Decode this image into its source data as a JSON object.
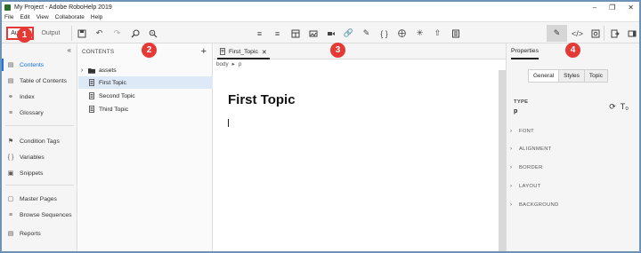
{
  "window": {
    "title": "My Project - Adobe RoboHelp 2019"
  },
  "menu": [
    "File",
    "Edit",
    "View",
    "Collaborate",
    "Help"
  ],
  "modes": {
    "author": "Author",
    "output": "Output"
  },
  "callouts": [
    "1",
    "2",
    "3",
    "4"
  ],
  "nav": {
    "items": [
      {
        "label": "Contents",
        "icon": "contents-icon",
        "active": true
      },
      {
        "label": "Table of Contents",
        "icon": "toc-icon"
      },
      {
        "label": "Index",
        "icon": "key-icon"
      },
      {
        "label": "Glossary",
        "icon": "glossary-icon"
      },
      {
        "label": "Condition Tags",
        "icon": "tag-icon"
      },
      {
        "label": "Variables",
        "icon": "braces-icon"
      },
      {
        "label": "Snippets",
        "icon": "snippet-icon"
      },
      {
        "label": "Master Pages",
        "icon": "master-page-icon"
      },
      {
        "label": "Browse Sequences",
        "icon": "sequence-icon"
      },
      {
        "label": "Reports",
        "icon": "reports-icon"
      }
    ]
  },
  "contents": {
    "header": "CONTENTS",
    "tree": [
      {
        "label": "assets",
        "type": "folder"
      },
      {
        "label": "First Topic",
        "type": "topic",
        "selected": true
      },
      {
        "label": "Second Topic",
        "type": "topic"
      },
      {
        "label": "Third Topic",
        "type": "topic"
      }
    ]
  },
  "editor": {
    "tab": "First_Topic",
    "breadcrumb": [
      "body",
      "p"
    ],
    "heading": "First Topic"
  },
  "properties": {
    "header": "Properties",
    "tabs": [
      "General",
      "Styles",
      "Topic"
    ],
    "active_tab": "General",
    "type_label": "TYPE",
    "type_value": "p",
    "sections": [
      "FONT",
      "ALIGNMENT",
      "BORDER",
      "LAYOUT",
      "BACKGROUND"
    ]
  },
  "colors": {
    "accent": "#1473e6",
    "callout": "#e53935",
    "frame": "#6f93b6"
  }
}
